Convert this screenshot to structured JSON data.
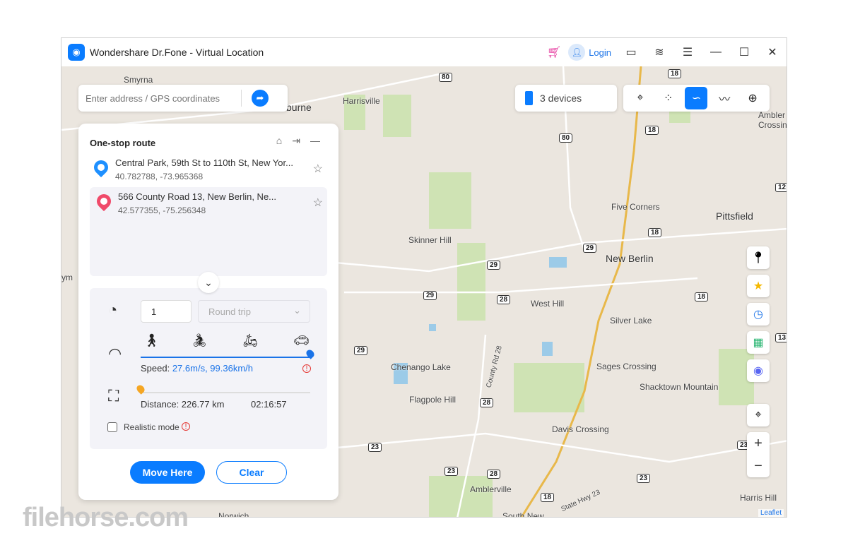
{
  "app": {
    "title": "Wondershare Dr.Fone - Virtual Location",
    "login": "Login"
  },
  "titlebar_icons": [
    "cart-icon",
    "user-icon",
    "camera-icon",
    "wifi-icon",
    "list-icon",
    "minimize-icon",
    "maximize-icon",
    "close-icon"
  ],
  "search": {
    "placeholder": "Enter address / GPS coordinates"
  },
  "devices": {
    "label": "3 devices"
  },
  "modes": {
    "items": [
      "teleport-mode",
      "jump-teleport-mode",
      "one-stop-route-mode",
      "multi-stop-route-mode",
      "joystick-mode"
    ],
    "active": "one-stop-route-mode"
  },
  "panel": {
    "title": "One-stop route",
    "stops": [
      {
        "name": "Central Park, 59th St to 110th St, New Yor...",
        "coords": "40.782788, -73.965368",
        "color": "#1e90ff"
      },
      {
        "name": "566 County Road 13, New Berlin, Ne...",
        "coords": "42.577355, -75.256348",
        "color": "#f04a6a"
      }
    ],
    "repeat_count": "1",
    "trip_mode": "Round trip",
    "speed_label": "Speed:",
    "speed_value": "27.6m/s, 99.36km/h",
    "speed_level": 1.0,
    "distance": "Distance: 226.77 km",
    "time": "02:16:57",
    "progress": 0.0,
    "realistic_mode": "Realistic mode",
    "realistic_checked": false,
    "move_here": "Move Here",
    "clear": "Clear"
  },
  "map": {
    "labels": [
      {
        "t": "Smyrna"
      },
      {
        "t": "Harrisville"
      },
      {
        "t": "burne"
      },
      {
        "t": "Five Corners"
      },
      {
        "t": "Pittsfield"
      },
      {
        "t": "Skinner Hill"
      },
      {
        "t": "New Berlin"
      },
      {
        "t": "West Hill"
      },
      {
        "t": "Silver Lake"
      },
      {
        "t": "Chenango Lake"
      },
      {
        "t": "County Rd 28"
      },
      {
        "t": "Sages Crossing"
      },
      {
        "t": "Shacktown Mountain"
      },
      {
        "t": "Flagpole Hill"
      },
      {
        "t": "Davis Crossing"
      },
      {
        "t": "Amblerville"
      },
      {
        "t": "Harris Hill"
      },
      {
        "t": "State Hwy 23"
      },
      {
        "t": "South New"
      },
      {
        "t": "Norwich"
      },
      {
        "t": "Ambler Crossin"
      },
      {
        "t": "ym"
      }
    ],
    "shields": [
      "80",
      "18",
      "80",
      "18",
      "18",
      "29",
      "29",
      "29",
      "28",
      "29",
      "28",
      "18",
      "23",
      "23",
      "28",
      "23",
      "18",
      "23",
      "13",
      "12"
    ],
    "attribution": "Leaflet"
  },
  "watermark": "filehorse.com"
}
